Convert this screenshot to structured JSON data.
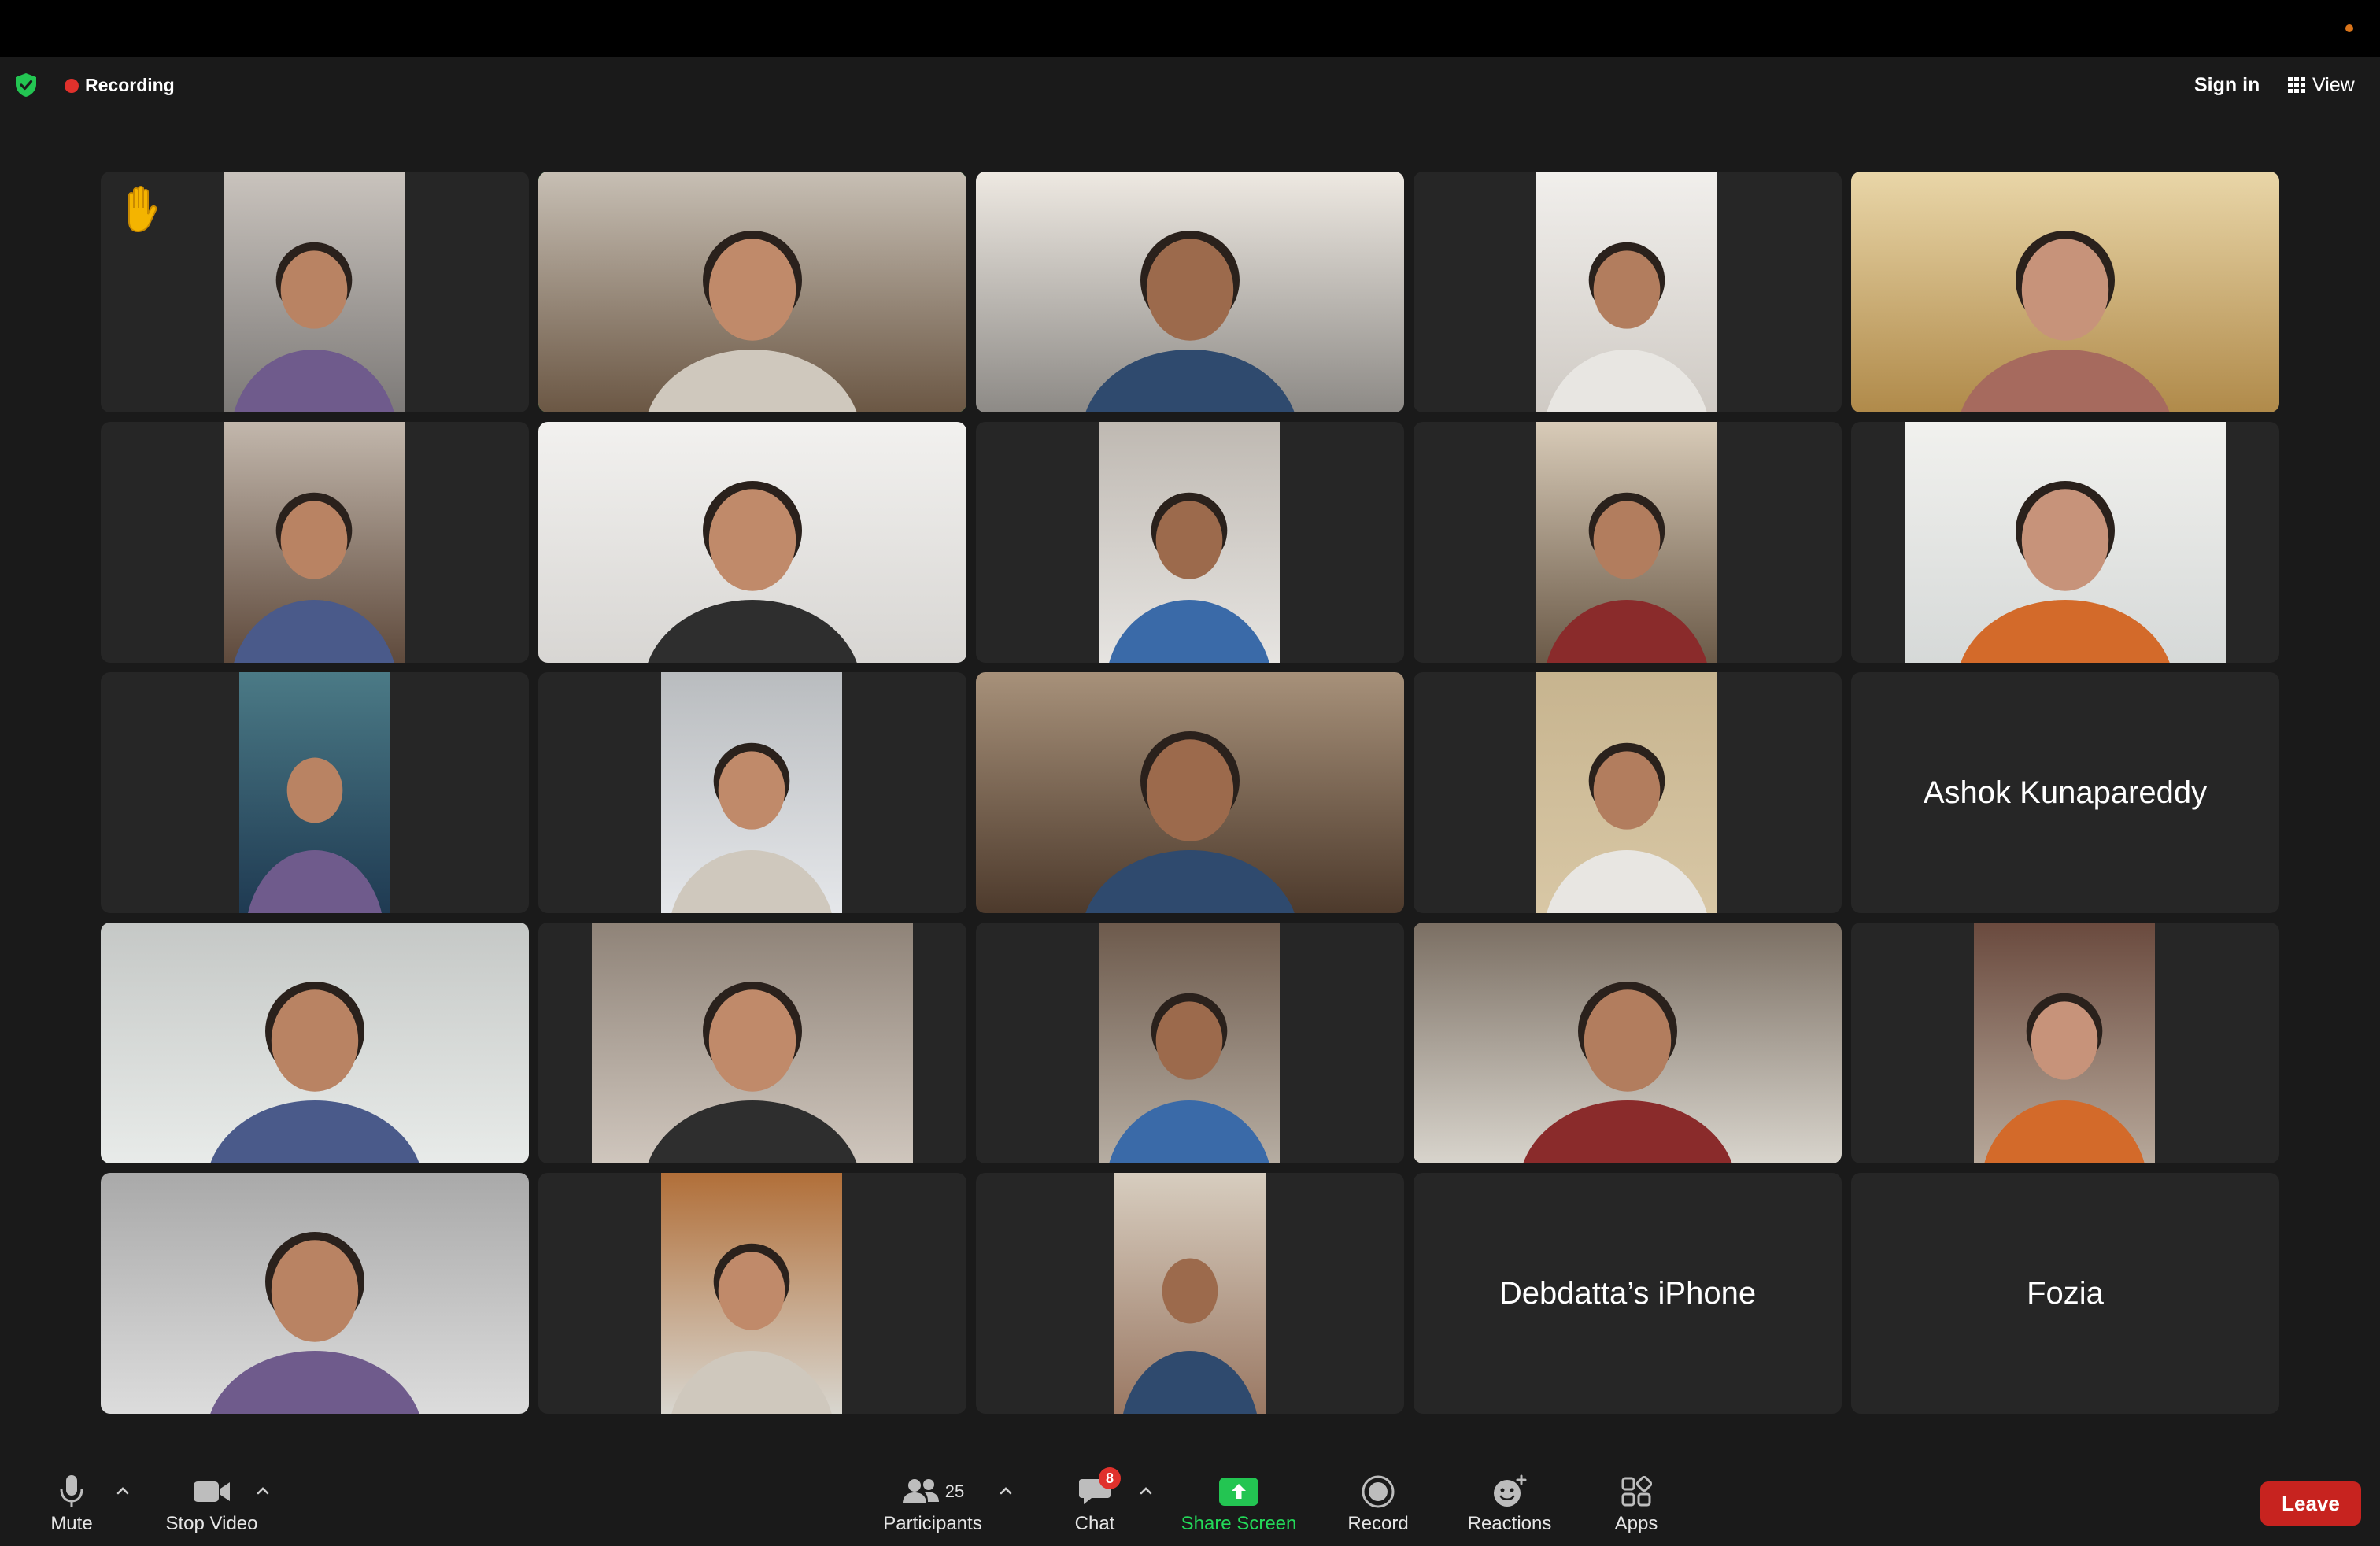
{
  "top_bar": {
    "recording_label": "Recording",
    "sign_in_label": "Sign in",
    "view_label": "View"
  },
  "gallery": {
    "tiles": [
      {
        "type": "video",
        "raised_hand": true
      },
      {
        "type": "video",
        "active_speaker": true
      },
      {
        "type": "video"
      },
      {
        "type": "video"
      },
      {
        "type": "video"
      },
      {
        "type": "video"
      },
      {
        "type": "video"
      },
      {
        "type": "video"
      },
      {
        "type": "video"
      },
      {
        "type": "video"
      },
      {
        "type": "image"
      },
      {
        "type": "video"
      },
      {
        "type": "video"
      },
      {
        "type": "video"
      },
      {
        "type": "name",
        "name": "Ashok Kunapareddy"
      },
      {
        "type": "video"
      },
      {
        "type": "video"
      },
      {
        "type": "video"
      },
      {
        "type": "video"
      },
      {
        "type": "video"
      },
      {
        "type": "video"
      },
      {
        "type": "video"
      },
      {
        "type": "image"
      },
      {
        "type": "name",
        "name": "Debdatta’s iPhone"
      },
      {
        "type": "name",
        "name": "Fozia"
      }
    ]
  },
  "toolbar": {
    "mute_label": "Mute",
    "stop_video_label": "Stop Video",
    "participants_label": "Participants",
    "participants_count": "25",
    "chat_label": "Chat",
    "chat_badge": "8",
    "share_screen_label": "Share Screen",
    "record_label": "Record",
    "reactions_label": "Reactions",
    "apps_label": "Apps",
    "leave_label": "Leave"
  },
  "colors": {
    "active_speaker_border": "#23d959",
    "recording_dot": "#e0312c",
    "leave_button": "#c7231f",
    "share_screen": "#23d959",
    "tile_background": "#262626"
  },
  "icons": {
    "shield": "shield-check-icon",
    "view": "grid-icon",
    "hand": "raised-hand-icon",
    "mute": "microphone-icon",
    "video": "video-camera-icon",
    "participants": "people-icon",
    "chat": "chat-bubble-icon",
    "share": "share-screen-icon",
    "record": "record-icon",
    "reactions": "emoji-add-icon",
    "apps": "apps-icon"
  }
}
